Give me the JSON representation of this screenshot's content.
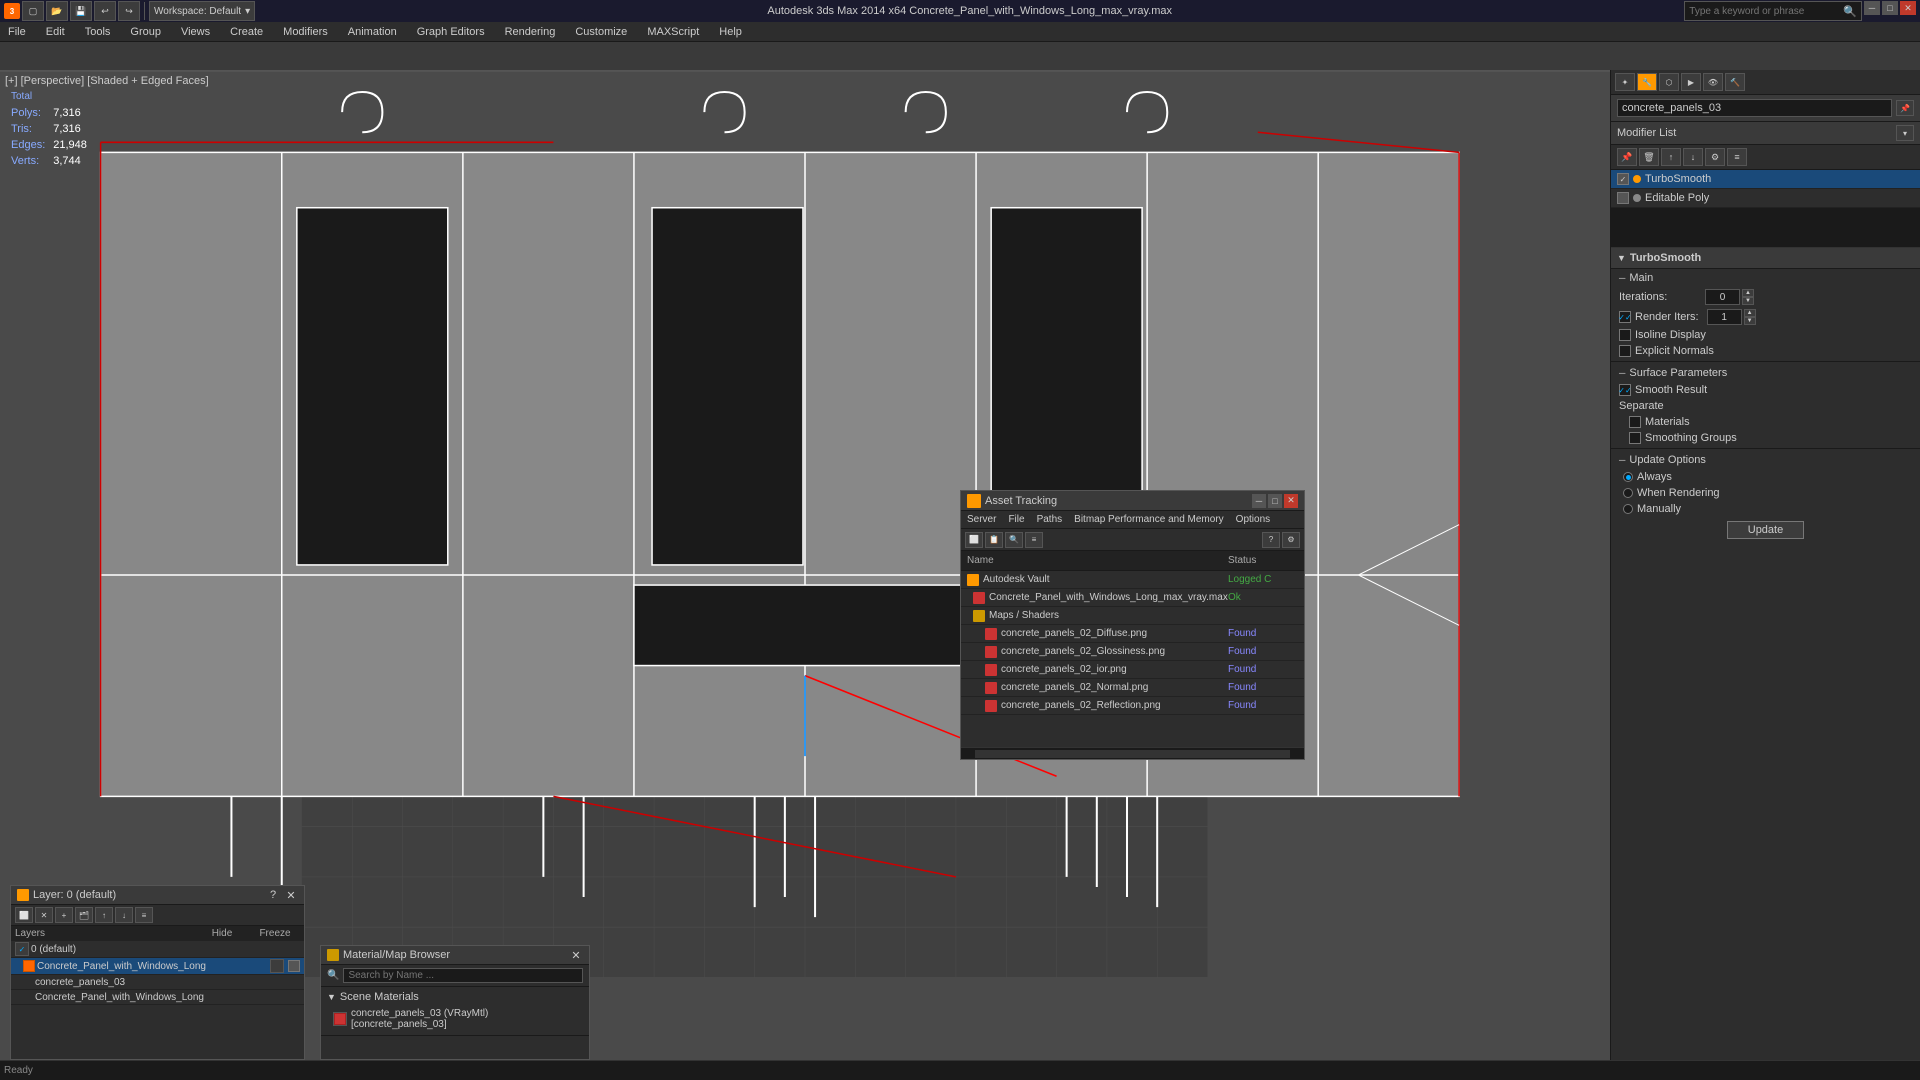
{
  "app": {
    "title": "Autodesk 3ds Max 2014 x64     Concrete_Panel_with_Windows_Long_max_vray.max",
    "workspace": "Workspace: Default",
    "viewport_label": "[+] [Perspective] [Shaded + Edged Faces]"
  },
  "menu": {
    "items": [
      "File",
      "Edit",
      "Tools",
      "Group",
      "Views",
      "Create",
      "Modifiers",
      "Animation",
      "Graph Editors",
      "Rendering",
      "Customize",
      "MAXScript",
      "Help"
    ]
  },
  "search": {
    "placeholder": "Type a keyword or phrase"
  },
  "stats": {
    "total_label": "Total",
    "polys_label": "Polys:",
    "polys_value": "7,316",
    "tris_label": "Tris:",
    "tris_value": "7,316",
    "edges_label": "Edges:",
    "edges_value": "21,948",
    "verts_label": "Verts:",
    "verts_value": "3,744"
  },
  "right_panel": {
    "object_name": "concrete_panels_03",
    "modifier_list_label": "Modifier List",
    "modifiers": [
      {
        "name": "TurboSmooth",
        "active": true
      },
      {
        "name": "Editable Poly",
        "active": false
      }
    ]
  },
  "turbosmooth": {
    "title": "TurboSmooth",
    "main_label": "Main",
    "iterations_label": "Iterations:",
    "iterations_value": "0",
    "render_iters_label": "Render Iters:",
    "render_iters_value": "1",
    "isoline_label": "Isoline Display",
    "explicit_label": "Explicit Normals",
    "surface_params_label": "Surface Parameters",
    "smooth_result_label": "Smooth Result",
    "smooth_result_checked": true,
    "separate_label": "Separate",
    "materials_label": "Materials",
    "smoothing_groups_label": "Smoothing Groups",
    "update_options_label": "Update Options",
    "always_label": "Always",
    "when_rendering_label": "When Rendering",
    "manually_label": "Manually",
    "update_btn_label": "Update",
    "always_selected": true,
    "when_rendering_selected": false,
    "manually_selected": false
  },
  "layer_panel": {
    "title": "Layer: 0 (default)",
    "columns": {
      "layers": "Layers",
      "hide": "Hide",
      "freeze": "Freeze"
    },
    "rows": [
      {
        "name": "0 (default)",
        "indent": 0,
        "checked": true,
        "type": "layer"
      },
      {
        "name": "Concrete_Panel_with_Windows_Long",
        "indent": 1,
        "checked": false,
        "type": "object",
        "has_box": true
      },
      {
        "name": "concrete_panels_03",
        "indent": 2,
        "checked": false,
        "type": "sub"
      },
      {
        "name": "Concrete_Panel_with_Windows_Long",
        "indent": 2,
        "checked": false,
        "type": "sub"
      }
    ]
  },
  "material_panel": {
    "title": "Material/Map Browser",
    "search_placeholder": "Search by Name ...",
    "scene_materials_label": "Scene Materials",
    "materials": [
      {
        "name": "concrete_panels_03 (VRayMtl) [concrete_panels_03]"
      }
    ]
  },
  "asset_panel": {
    "title": "Asset Tracking",
    "menu_items": [
      "Server",
      "File",
      "Paths",
      "Bitmap Performance and Memory",
      "Options"
    ],
    "columns": {
      "name": "Name",
      "status": "Status"
    },
    "rows": [
      {
        "name": "Autodesk Vault",
        "indent": 0,
        "status": "Logged C",
        "type": "vault"
      },
      {
        "name": "Concrete_Panel_with_Windows_Long_max_vray.max",
        "indent": 1,
        "status": "Ok",
        "type": "file"
      },
      {
        "name": "Maps / Shaders",
        "indent": 1,
        "status": "",
        "type": "folder"
      },
      {
        "name": "concrete_panels_02_Diffuse.png",
        "indent": 2,
        "status": "Found",
        "type": "map"
      },
      {
        "name": "concrete_panels_02_Glossiness.png",
        "indent": 2,
        "status": "Found",
        "type": "map"
      },
      {
        "name": "concrete_panels_02_ior.png",
        "indent": 2,
        "status": "Found",
        "type": "map"
      },
      {
        "name": "concrete_panels_02_Normal.png",
        "indent": 2,
        "status": "Found",
        "type": "map"
      },
      {
        "name": "concrete_panels_02_Reflection.png",
        "indent": 2,
        "status": "Found",
        "type": "map"
      }
    ]
  },
  "colors": {
    "accent_orange": "#ff9900",
    "accent_blue": "#1a4a7a",
    "status_ok": "#44aa44",
    "status_found": "#8888ff"
  }
}
